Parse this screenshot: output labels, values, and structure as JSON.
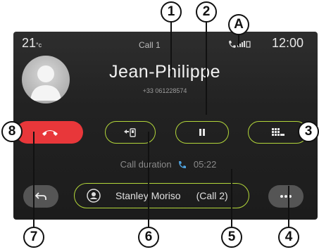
{
  "status_bar": {
    "temperature": "21",
    "temp_unit": "°c",
    "time": "12:00"
  },
  "call": {
    "title": "Call 1",
    "contact_name": "Jean-Philippe",
    "phone_number": "+33 061228574",
    "duration_label": "Call duration",
    "duration_value": "05:22"
  },
  "second_call": {
    "contact": "Stanley Moriso",
    "tag": "(Call 2)"
  },
  "callouts": [
    "1",
    "2",
    "A",
    "3",
    "8",
    "7",
    "6",
    "5",
    "4"
  ],
  "colors": {
    "accent": "#b3d73a",
    "hangup": "#e8373a",
    "screen_bg": "#262626"
  }
}
